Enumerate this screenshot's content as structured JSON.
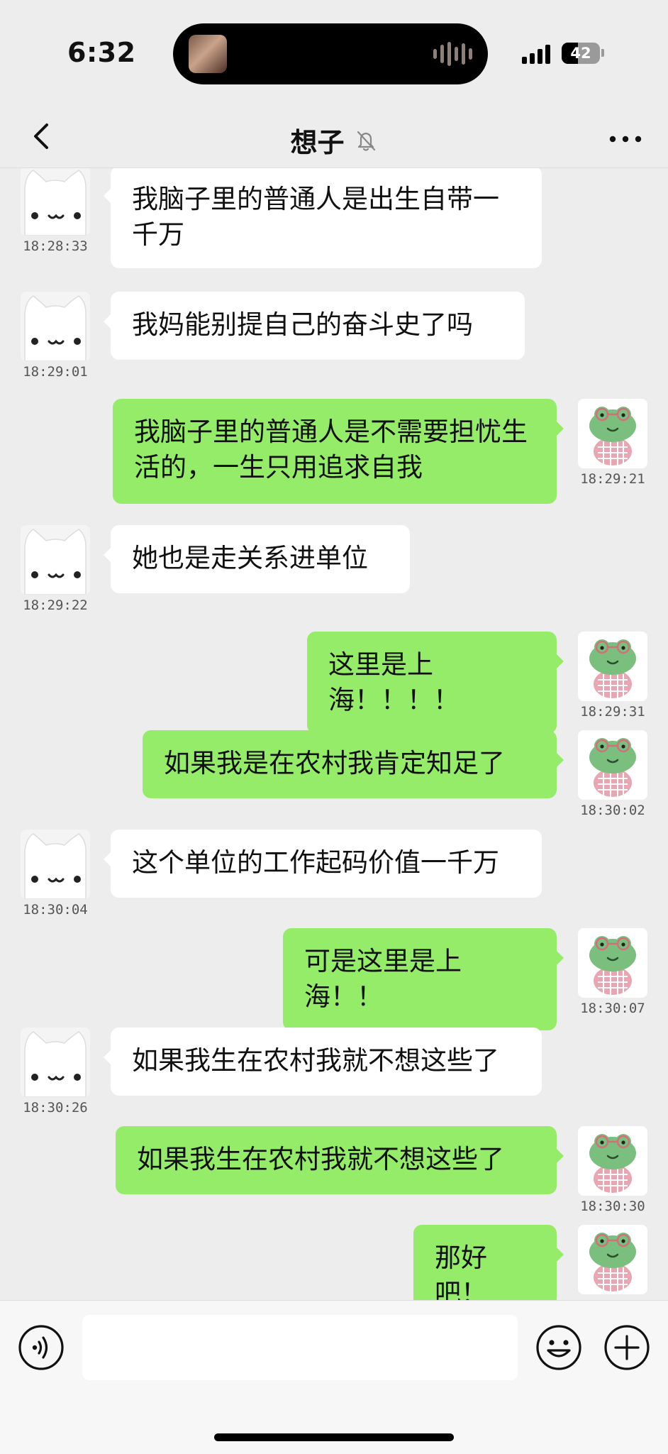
{
  "status_bar": {
    "time": "6:32",
    "battery_level": "42",
    "battery_fraction": 0.42
  },
  "header": {
    "title": "想子",
    "back_icon": "chevron-left-icon",
    "mute_icon": "bell-off-icon",
    "more_icon": "more-horizontal-icon"
  },
  "messages": [
    {
      "side": "left",
      "text": "我脑子里的普通人是出生自带一千万",
      "time": "18:28:33"
    },
    {
      "side": "left",
      "text": "我妈能别提自己的奋斗史了吗",
      "time": "18:29:01"
    },
    {
      "side": "right",
      "text": "我脑子里的普通人是不需要担忧生活的，一生只用追求自我",
      "time": "18:29:21"
    },
    {
      "side": "left",
      "text": "她也是走关系进单位",
      "time": "18:29:22"
    },
    {
      "side": "right",
      "text": "这里是上海！！！！",
      "time": "18:29:31"
    },
    {
      "side": "right",
      "text": "如果我是在农村我肯定知足了",
      "time": "18:30:02"
    },
    {
      "side": "left",
      "text": "这个单位的工作起码价值一千万",
      "time": "18:30:04"
    },
    {
      "side": "right",
      "text": "可是这里是上海！！",
      "time": "18:30:07"
    },
    {
      "side": "left",
      "text": "如果我生在农村我就不想这些了",
      "time": "18:30:26"
    },
    {
      "side": "right",
      "text": "如果我生在农村我就不想这些了",
      "time": "18:30:30"
    },
    {
      "side": "right",
      "text": "那好吧！",
      "time": ""
    }
  ],
  "input_bar": {
    "placeholder": "",
    "voice_icon": "voice-icon",
    "emoji_icon": "emoji-icon",
    "plus_icon": "plus-circle-icon"
  },
  "colors": {
    "background": "#ededed",
    "bubble_self": "#95ec69",
    "bubble_other": "#ffffff"
  }
}
